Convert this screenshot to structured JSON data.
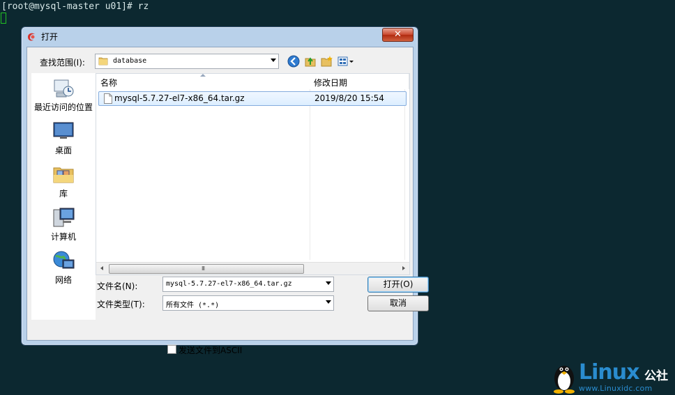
{
  "terminal": {
    "prompt": "[root@mysql-master u01]# rz"
  },
  "dialog": {
    "title": "打开",
    "close_label": "✕",
    "look_in_label": "查找范围(I):",
    "look_in_value": "database",
    "places": [
      {
        "label": "最近访问的位置",
        "icon": "recent-places-icon"
      },
      {
        "label": "桌面",
        "icon": "desktop-icon"
      },
      {
        "label": "库",
        "icon": "libraries-icon"
      },
      {
        "label": "计算机",
        "icon": "computer-icon"
      },
      {
        "label": "网络",
        "icon": "network-icon"
      }
    ],
    "columns": {
      "name": "名称",
      "modified": "修改日期"
    },
    "files": [
      {
        "name": "mysql-5.7.27-el7-x86_64.tar.gz",
        "modified": "2019/8/20 15:54"
      }
    ],
    "scroll_grip": "III",
    "filename_label": "文件名(N):",
    "filename_value": "mysql-5.7.27-el7-x86_64.tar.gz",
    "filetype_label": "文件类型(T):",
    "filetype_value": "所有文件 (*.*)",
    "open_button": "打开(O)",
    "cancel_button": "取消",
    "ascii_label": "发送文件到ASCII"
  },
  "watermark": {
    "brand": "Linux",
    "brand_cn": "公社",
    "url": "www.Linuxidc.com"
  },
  "colors": {
    "terminal_bg": "#0c2830",
    "dialog_frame": "#b9d1ea",
    "selection_border": "#84acdd",
    "brand_blue": "#2a8ccf"
  }
}
